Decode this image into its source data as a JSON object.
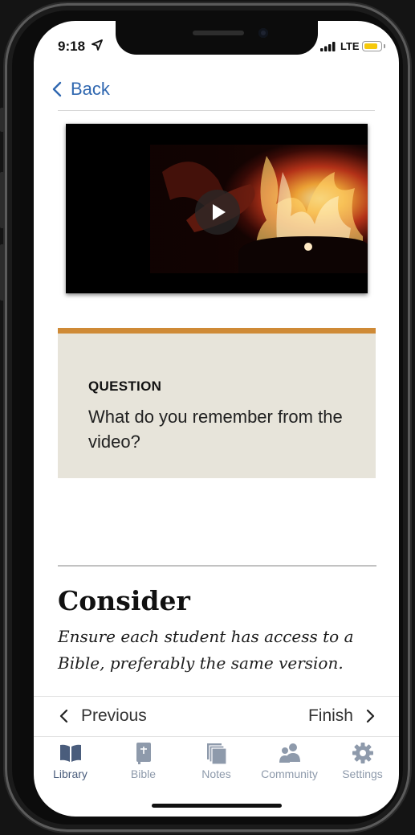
{
  "status_bar": {
    "time": "9:18",
    "network": "LTE"
  },
  "nav": {
    "back_label": "Back"
  },
  "question": {
    "label": "QUESTION",
    "text": "What do you remember from the video?"
  },
  "consider": {
    "title": "Consider",
    "body": "Ensure each student has access to a Bible, preferably the same version."
  },
  "pager": {
    "previous_label": "Previous",
    "next_label": "Finish"
  },
  "tabs": [
    {
      "label": "Library",
      "icon": "book-icon",
      "active": true
    },
    {
      "label": "Bible",
      "icon": "bible-icon",
      "active": false
    },
    {
      "label": "Notes",
      "icon": "notes-icon",
      "active": false
    },
    {
      "label": "Community",
      "icon": "community-icon",
      "active": false
    },
    {
      "label": "Settings",
      "icon": "gear-icon",
      "active": false
    }
  ],
  "colors": {
    "accent_blue": "#2f67b0",
    "card_bg": "#e7e4da",
    "card_border": "#cf8a36",
    "tab_active": "#4a5d7c",
    "tab_inactive": "#8e9aab"
  }
}
